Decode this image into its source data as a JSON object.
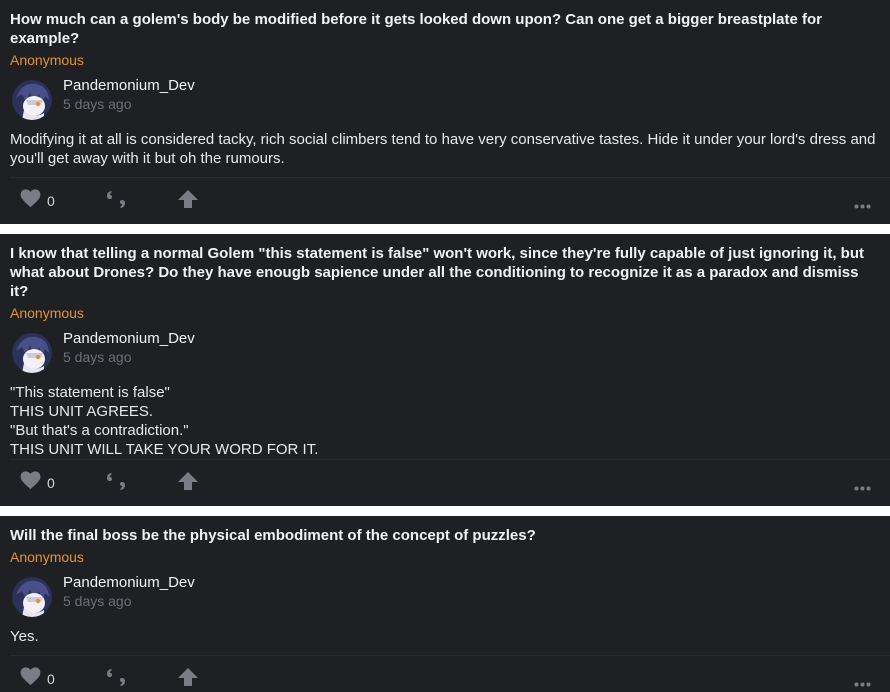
{
  "posts": [
    {
      "question": "How much can a golem's body be modified before it gets looked down upon? Can one get a bigger breastplate for example?",
      "asker": "Anonymous",
      "answerer": "Pandemonium_Dev",
      "time": "5 days ago",
      "answer_lines": [
        "Modifying it at all is considered tacky, rich social climbers tend to have very conservative tastes. Hide it under your lord's dress and you'll get away with it but oh the rumours."
      ],
      "likes": "0"
    },
    {
      "question": "I know that telling a normal Golem \"this statement is false\" won't work, since they're fully capable of just ignoring it, but what about Drones? Do they have enougb sapience under all the conditioning to recognize it as a paradox and dismiss it?",
      "asker": "Anonymous",
      "answerer": "Pandemonium_Dev",
      "time": "5 days ago",
      "answer_lines": [
        "\"This statement is false\"",
        "THIS UNIT AGREES.",
        "\"But that's a contradiction.\"",
        "THIS UNIT WILL TAKE YOUR WORD FOR IT."
      ],
      "likes": "0"
    },
    {
      "question": "Will the final boss be the physical embodiment of the concept of puzzles?",
      "asker": "Anonymous",
      "answerer": "Pandemonium_Dev",
      "time": "5 days ago",
      "answer_lines": [
        "Yes."
      ],
      "likes": "0"
    }
  ],
  "icons": {
    "like": "heart-icon",
    "share": "quote-share-icon",
    "boost": "arrow-up-icon",
    "more": "more-dots-icon"
  },
  "colors": {
    "card_bg": "#1f2024",
    "accent": "#e8912d",
    "muted": "#6e7077",
    "icon": "#7b7d84",
    "text": "#e9e9eb"
  }
}
